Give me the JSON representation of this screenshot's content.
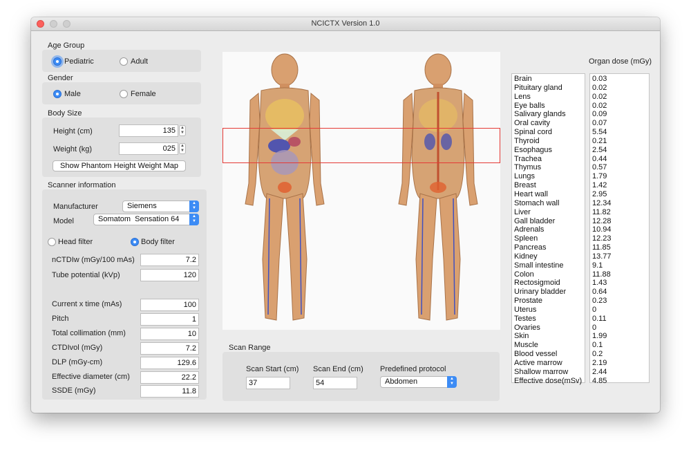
{
  "window": {
    "title": "NCICTX Version 1.0"
  },
  "age_group": {
    "title": "Age Group",
    "options": [
      "Pediatric",
      "Adult"
    ],
    "selected": "Pediatric"
  },
  "gender": {
    "title": "Gender",
    "options": [
      "Male",
      "Female"
    ],
    "selected": "Male"
  },
  "body_size": {
    "title": "Body Size",
    "height_label": "Height (cm)",
    "height_value": "135",
    "weight_label": "Weight (kg)",
    "weight_value": "025",
    "map_button": "Show Phantom Height Weight Map"
  },
  "scanner": {
    "title": "Scanner information",
    "manufacturer_label": "Manufacturer",
    "manufacturer_value": "Siemens",
    "model_label": "Model",
    "model_value": "Somatom  Sensation 64",
    "filters": [
      "Head filter",
      "Body filter"
    ],
    "selected_filter": "Body filter",
    "nctdi_label": "nCTDIw (mGy/100 mAs)",
    "nctdi_value": "7.2",
    "kvp_label": "Tube potential (kVp)",
    "kvp_value": "120",
    "mas_label": "Current x time (mAs)",
    "mas_value": "100",
    "pitch_label": "Pitch",
    "pitch_value": "1",
    "collimation_label": "Total collimation (mm)",
    "collimation_value": "10",
    "ctdivol_label": "CTDIvol (mGy)",
    "ctdivol_value": "7.2",
    "dlp_label": "DLP (mGy-cm)",
    "dlp_value": "129.6",
    "diameter_label": "Effective diameter (cm)",
    "diameter_value": "22.2",
    "ssde_label": "SSDE (mGy)",
    "ssde_value": "11.8"
  },
  "scan_range": {
    "title": "Scan Range",
    "start_label": "Scan Start (cm)",
    "start_value": "37",
    "end_label": "Scan End (cm)",
    "end_value": "54",
    "protocol_label": "Predefined protocol",
    "protocol_value": "Abdomen"
  },
  "organ_dose": {
    "title": "Organ dose (mGy)",
    "organs": [
      "Brain",
      "Pituitary gland",
      "Lens",
      "Eye balls",
      "Salivary glands",
      "Oral cavity",
      "Spinal cord",
      "Thyroid",
      "Esophagus",
      "Trachea",
      "Thymus",
      "Lungs",
      "Breast",
      "Heart wall",
      "Stomach wall",
      "Liver",
      "Gall bladder",
      "Adrenals",
      "Spleen",
      "Pancreas",
      "Kidney",
      "Small intestine",
      "Colon",
      "Rectosigmoid",
      "Urinary bladder",
      "Prostate",
      "Uterus",
      "Testes",
      "Ovaries",
      "Skin",
      "Muscle",
      "Blood vessel",
      "Active marrow",
      "Shallow marrow",
      "Effective dose(mSv)"
    ],
    "doses": [
      "0.03",
      "0.02",
      "0.02",
      "0.02",
      "0.09",
      "0.07",
      "5.54",
      "0.21",
      "2.54",
      "0.44",
      "0.57",
      "1.79",
      "1.42",
      "2.95",
      "12.34",
      "11.82",
      "12.28",
      "10.94",
      "12.23",
      "11.85",
      "13.77",
      "9.1",
      "11.88",
      "1.43",
      "0.64",
      "0.23",
      "0",
      "0.11",
      "0",
      "1.99",
      "0.1",
      "0.2",
      "2.19",
      "2.44",
      "4.85"
    ]
  },
  "colors": {
    "accent": "#3d8cf5",
    "scan_box": "#e53935",
    "window_bg": "#ececec"
  }
}
